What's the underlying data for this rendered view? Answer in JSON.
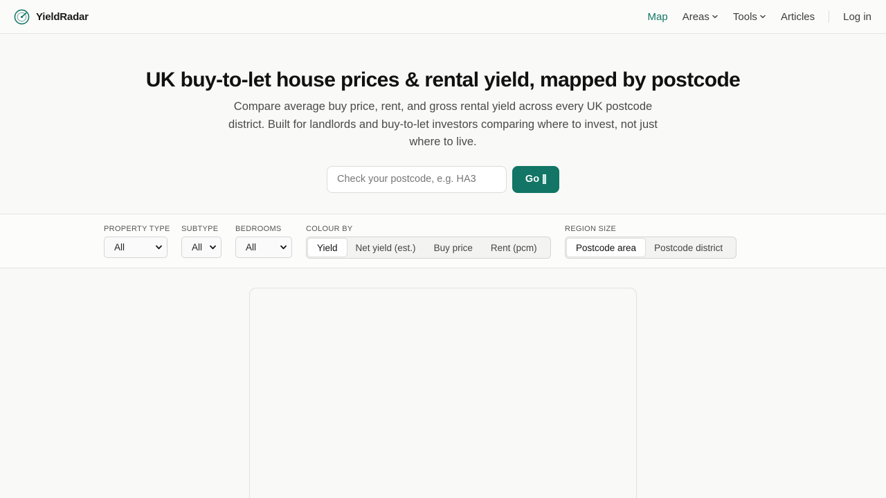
{
  "brand": {
    "name": "YieldRadar",
    "logo_icon": "radar-logo-icon",
    "accent": "#127565"
  },
  "nav": {
    "items": [
      {
        "label": "Map",
        "active": true
      },
      {
        "label": "Areas",
        "dropdown": true
      },
      {
        "label": "Tools",
        "dropdown": true
      },
      {
        "label": "Articles"
      }
    ],
    "login_label": "Log in"
  },
  "hero": {
    "title": "UK buy-to-let house prices & rental yield, mapped by postcode",
    "subtitle": "Compare average buy price, rent, and gross rental yield across every UK postcode district. Built for landlords and buy-to-let investors comparing where to invest, not just where to live.",
    "search_placeholder": "Check your postcode, e.g. HA3",
    "search_value": "",
    "go_label": "Go"
  },
  "filters": {
    "property_type": {
      "label": "PROPERTY TYPE",
      "value": "All"
    },
    "subtype": {
      "label": "SUBTYPE",
      "value": "All"
    },
    "bedrooms": {
      "label": "BEDROOMS",
      "value": "All"
    },
    "colour_by": {
      "label": "COLOUR BY",
      "options": [
        "Yield",
        "Net yield (est.)",
        "Buy price",
        "Rent (pcm)"
      ],
      "selected": "Yield"
    },
    "region_size": {
      "label": "REGION SIZE",
      "options": [
        "Postcode area",
        "Postcode district"
      ],
      "selected": "Postcode area"
    }
  }
}
